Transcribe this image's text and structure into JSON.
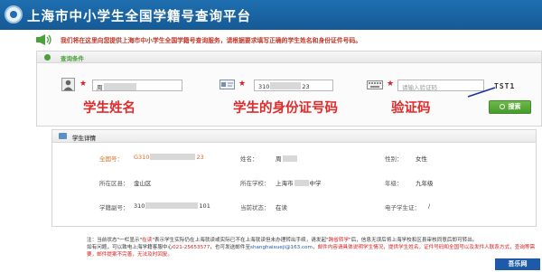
{
  "header": {
    "title": "上海市中小学生全国学籍号查询平台"
  },
  "notice": {
    "text": "我们将在这里向您提供上海市中小学生全国学籍号查询服务，请根据要求填写正确的学生姓名和身份证件号码。"
  },
  "query": {
    "panel_title": "查询条件",
    "name_value": "周",
    "id_value_prefix": "310",
    "id_value_suffix": "23",
    "captcha_placeholder": "请输入验证码",
    "captcha_text": "TST1",
    "search_label": "搜索"
  },
  "annotations": {
    "name": "学生姓名",
    "id": "学生的身份证号码",
    "captcha": "验证码"
  },
  "details": {
    "panel_title": "学生详情",
    "row1": {
      "label1": "全国号：",
      "value1_prefix": "G310",
      "value1_suffix": "23",
      "label2": "姓名：",
      "value2": "周",
      "label3": "性别：",
      "value3": "女性"
    },
    "row2": {
      "label1": "所在区县：",
      "value1": "金山区",
      "label2": "所在学校：",
      "value2_prefix": "上海市",
      "value2_suffix": "中学",
      "label3": "年级：",
      "value3": "九年级"
    },
    "row3": {
      "label1": "学籍副号：",
      "value1_prefix": "310",
      "value1_suffix": "101",
      "label2": "当前状态：",
      "value2": "在读",
      "label3": "电子学生证：",
      "value3": "/"
    }
  },
  "notes": {
    "line1_a": "注：",
    "line1_b": "当前状态\"一栏显示\"",
    "line1_c": "在读",
    "line1_d": "\"表示学生实际仍在上海就读或实际已不在上海就读但未办理转出手续，请发起\"",
    "line1_e": "跨省转学",
    "line1_f": "\"后，信息无误后将上海学校和区县审核同意后即可转出。",
    "line2_a": "如有问题，可以致电上海学籍客服中心",
    "line2_b": "021-25653577",
    "line2_c": "，也可发送邮件至",
    "line2_d": "shanghaixueji@163.com",
    "line2_e": "，邮件内容请具体说明学生情况，提供学生姓名，证件号码和全国号以及发件人联系方式，查询等需要，邮件提案不完善，无法及时回复。"
  },
  "watermark": {
    "text": "吾乐网"
  }
}
